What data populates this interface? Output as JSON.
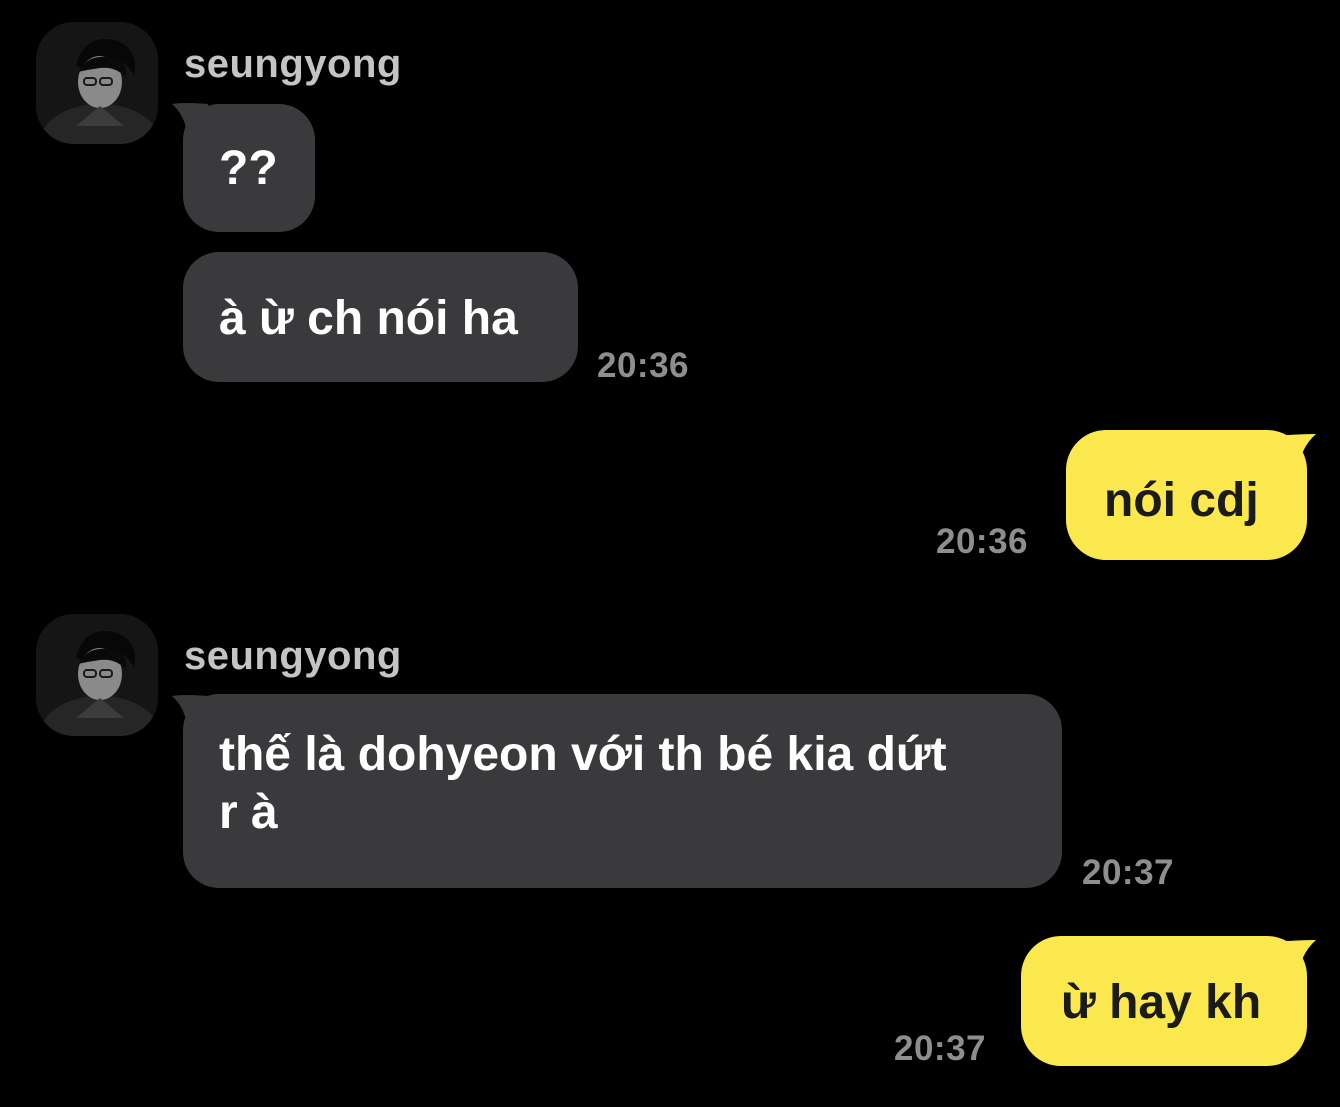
{
  "chat": {
    "colors": {
      "background": "#000000",
      "incoming_bubble": "#3a3a3c",
      "outgoing_bubble": "#fae84e",
      "timestamp": "#8e8e8e",
      "sender_name": "#c4c4c4"
    },
    "groups": [
      {
        "sender": "seungyong",
        "avatar_icon": "profile-photo-avatar",
        "messages": [
          {
            "text": "??"
          },
          {
            "text": "à ừ ch nói ha",
            "time": "20:36"
          }
        ]
      },
      {
        "sender": "me",
        "messages": [
          {
            "text": "nói cdj",
            "time": "20:36"
          }
        ]
      },
      {
        "sender": "seungyong",
        "avatar_icon": "profile-photo-avatar",
        "messages": [
          {
            "text_line1": "thế là dohyeon với th bé kia dứt",
            "text_line2": "r à",
            "time": "20:37"
          }
        ]
      },
      {
        "sender": "me",
        "messages": [
          {
            "text": "ừ hay kh",
            "time": "20:37"
          }
        ]
      }
    ]
  }
}
